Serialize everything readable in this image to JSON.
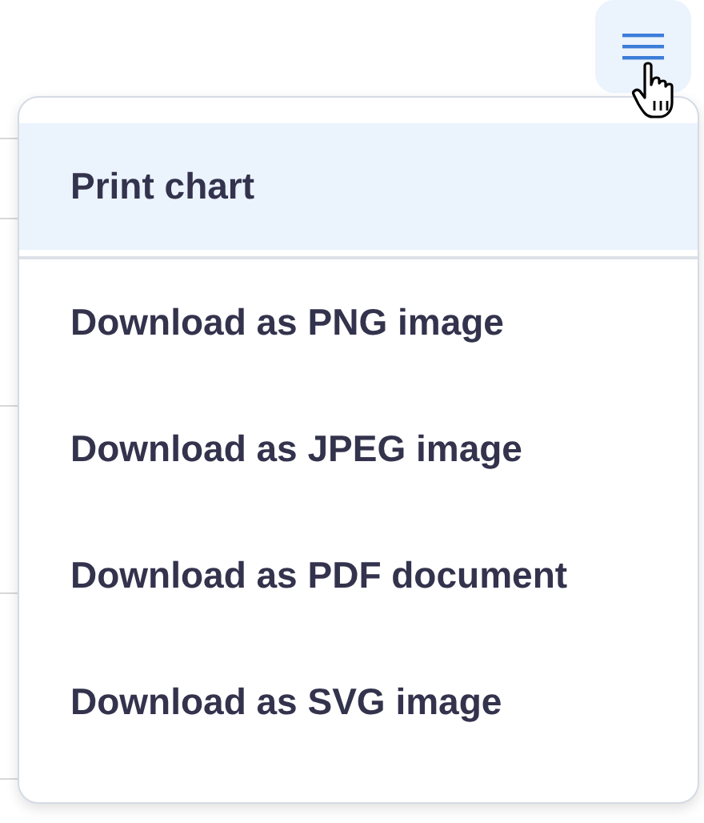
{
  "menu_button": {
    "selected": true
  },
  "menu": {
    "groups": [
      [
        {
          "label": "Print chart",
          "selected": true
        }
      ],
      [
        {
          "label": "Download as PNG image",
          "selected": false
        },
        {
          "label": "Download as JPEG image",
          "selected": false
        },
        {
          "label": "Download as PDF document",
          "selected": false
        },
        {
          "label": "Download as SVG image",
          "selected": false
        }
      ]
    ]
  }
}
